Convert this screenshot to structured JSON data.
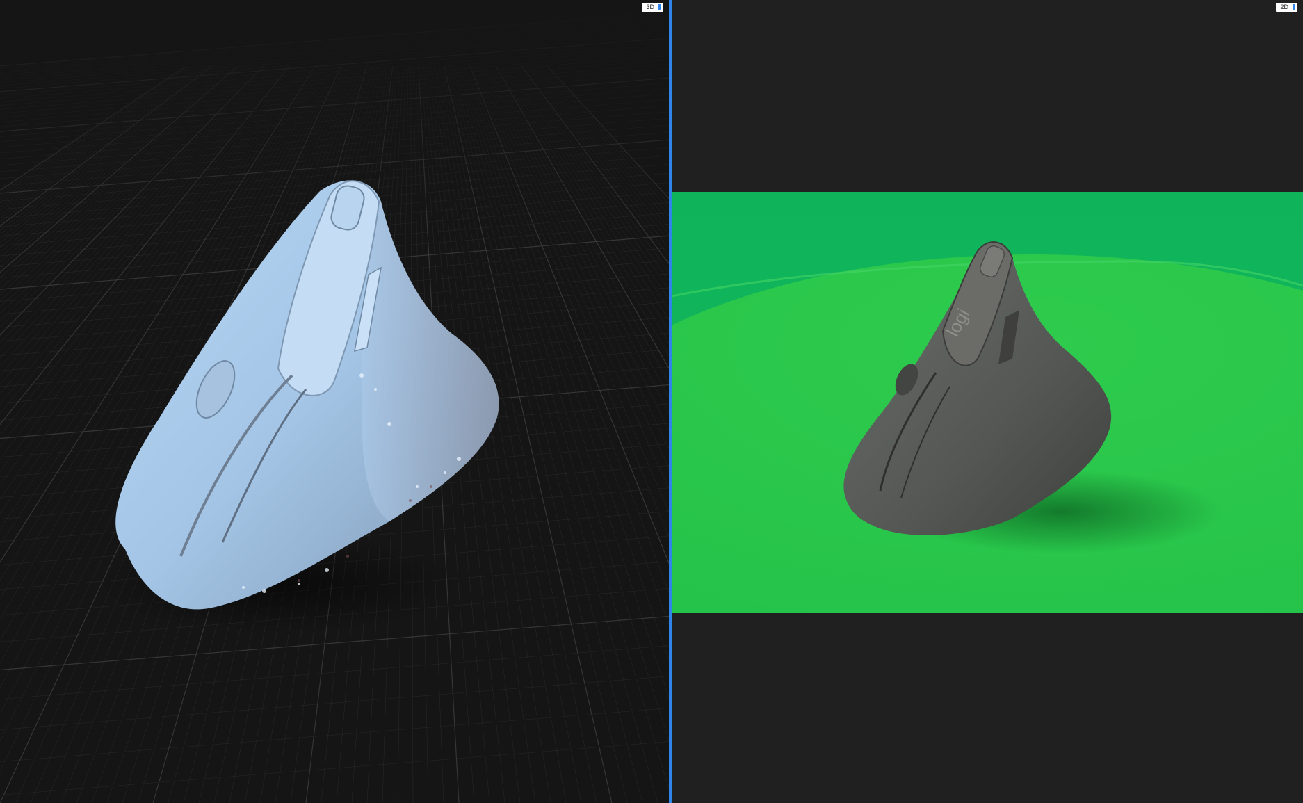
{
  "viewer": {
    "left_panel": {
      "mode_label": "3D"
    },
    "right_panel": {
      "mode_label": "2D"
    }
  },
  "colors": {
    "splitter": "#2f86e8",
    "background_3d": "#151515",
    "background_2d": "#202020",
    "grid_line": "#3a3a3a",
    "model_surface": "#9fc3e6",
    "photo_backdrop": "#1fbf55"
  },
  "icons": {
    "mode_3d": "cube-icon",
    "mode_2d": "image-icon"
  }
}
